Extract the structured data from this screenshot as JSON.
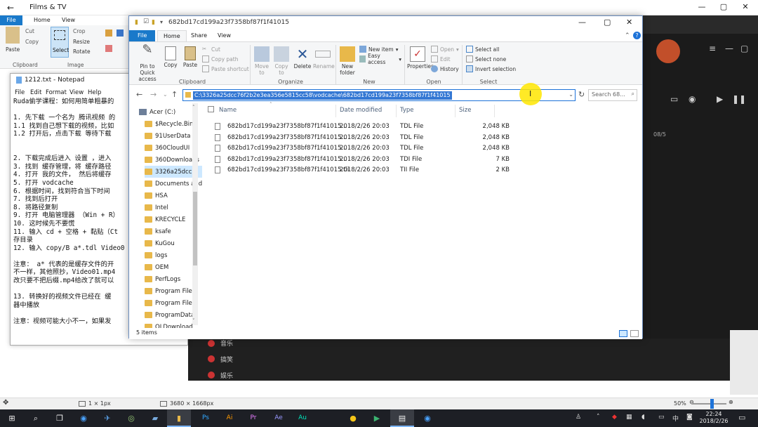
{
  "films": {
    "title": "Films & TV",
    "back_icon": "←",
    "win_min": "—",
    "win_max": "▢",
    "win_close": "✕",
    "counter": "08/5",
    "menu_items": [
      "音乐",
      "搞笑",
      "娱乐"
    ]
  },
  "paint": {
    "tabs": [
      "File",
      "Home",
      "View"
    ],
    "groups": [
      "Clipboard",
      "Image"
    ],
    "buttons": {
      "paste": "Paste",
      "cut": "Cut",
      "copy": "Copy",
      "select": "Select",
      "crop": "Crop",
      "resize": "Resize",
      "rotate": "Rotate"
    },
    "status": {
      "size_sel": "1 × 1px",
      "size_img": "3680 × 1668px",
      "zoom": "50%"
    }
  },
  "notepad": {
    "title": "1212.txt - Notepad",
    "menu": [
      "File",
      "Edit",
      "Format",
      "View",
      "Help"
    ],
    "lines": [
      "Ruda偷学课程：如何用简单粗暴的",
      "",
      "1. 先下载 一个名为 腾讯视频 的",
      "1.1 找到自己想下载的视频，比如",
      "1.2 打开后，点击下载 等待下载",
      "",
      "",
      "2. 下载完成后进入 设置 ，进入",
      "3. 找到 缓存管理，将 缓存路径",
      "4. 打开 我的文件， 然后将缓存",
      "5. 打开 vodcache",
      "6. 根据时间，找到符合当下时间",
      "7. 找到后打开",
      "8. 将路径复制",
      "9. 打开 电脑管理器 （Win + R）",
      "10. 这时候先不要慌",
      "11. 输入 cd + 空格 + 黏贴（Ct",
      "存目录",
      "12. 输入 copy/B a*.tdl Video0",
      "",
      "注意： a* 代表的是缓存文件的开",
      "不一样，其他照抄，Video01.mp4",
      "改只要不把后缀.mp4给改了就可以",
      "",
      "13. 转换好的视频文件已经在 缓",
      "器中播放",
      "",
      "注意：视频可能大小不一，如果发"
    ]
  },
  "explorer": {
    "title": "682bd17cd199a23f7358bf87f1f41015",
    "tabs": [
      "File",
      "Home",
      "Share",
      "View"
    ],
    "ribbon": {
      "pin": "Pin to Quick access",
      "copy": "Copy",
      "paste": "Paste",
      "cut": "Cut",
      "copy_path": "Copy path",
      "paste_shortcut": "Paste shortcut",
      "move_to": "Move to",
      "copy_to": "Copy to",
      "delete": "Delete",
      "rename": "Rename",
      "new_folder": "New folder",
      "new_item": "New item",
      "easy_access": "Easy access",
      "properties": "Properties",
      "open": "Open",
      "edit": "Edit",
      "history": "History",
      "select_all": "Select all",
      "select_none": "Select none",
      "invert_selection": "Invert selection",
      "groups": [
        "Clipboard",
        "Organize",
        "New",
        "Open",
        "Select"
      ]
    },
    "address": "C:\\3326a25dcc76f2b2e3ea356e5815cc58\\vodcache\\682bd17cd199a23f7358bf87f1f41015",
    "search_placeholder": "Search 68...",
    "tree": [
      "Acer (C:)",
      "$Recycle.Bin",
      "91UserData",
      "360CloudUI",
      "360Downloads",
      "3326a25dcc7",
      "Documents and",
      "HSA",
      "Intel",
      "KRECYCLE",
      "ksafe",
      "KuGou",
      "logs",
      "OEM",
      "PerfLogs",
      "Program Files",
      "Program Files",
      "ProgramData",
      "QLDownload"
    ],
    "columns": [
      "Name",
      "Date modified",
      "Type",
      "Size"
    ],
    "files": [
      {
        "name": "682bd17cd199a23f7358bf87f1f41015...",
        "date": "2018/2/26 20:03",
        "type": "TDL File",
        "size": "2,048 KB"
      },
      {
        "name": "682bd17cd199a23f7358bf87f1f41015...",
        "date": "2018/2/26 20:03",
        "type": "TDL File",
        "size": "2,048 KB"
      },
      {
        "name": "682bd17cd199a23f7358bf87f1f41015...",
        "date": "2018/2/26 20:03",
        "type": "TDL File",
        "size": "2,048 KB"
      },
      {
        "name": "682bd17cd199a23f7358bf87f1f41015...",
        "date": "2018/2/26 20:03",
        "type": "TDI File",
        "size": "7 KB"
      },
      {
        "name": "682bd17cd199a23f7358bf87f1f41015.tii",
        "date": "2018/2/26 20:03",
        "type": "TII File",
        "size": "2 KB"
      }
    ],
    "status": "5 items"
  },
  "taskbar": {
    "time": "22:24",
    "date": "2018/2/26",
    "ime": "中"
  }
}
